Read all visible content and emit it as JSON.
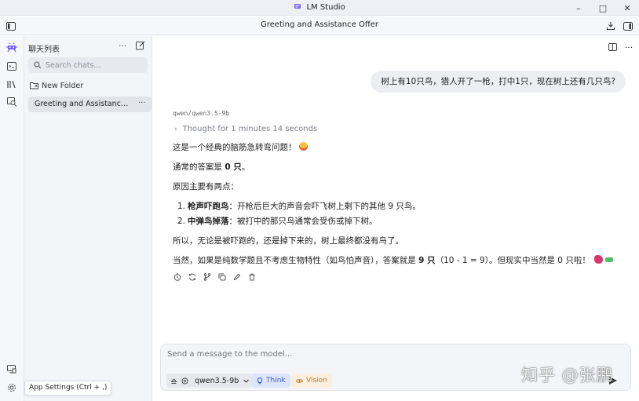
{
  "window": {
    "title": "LM Studio",
    "minimize": "–",
    "maximize": "□",
    "close": "✕"
  },
  "appbar": {
    "chat_title": "Greeting and Assistance Offer"
  },
  "sidebar": {
    "header": "聊天列表",
    "more": "···",
    "search_placeholder": "Search chats...",
    "folder_label": "New Folder",
    "chats": [
      {
        "label": "Greeting and Assistance Offer",
        "more": "···"
      }
    ],
    "tooltip": "App Settings (Ctrl + ,)"
  },
  "main": {
    "more": "···",
    "user_message": "树上有10只鸟，猎人开了一枪，打中1只，现在树上还有几只鸟?",
    "model_name": "qwen/qwen3.5-9b",
    "thought_label": "Thought for 1 minutes 14 seconds",
    "response": {
      "p1": "这是一个经典的脑筋急转弯问题！",
      "p2_prefix": "通常的答案是 ",
      "p2_bold": "0 只",
      "p2_suffix": "。",
      "p3": "原因主要有两点：",
      "list": [
        {
          "num": "1.",
          "bold": "枪声吓跑鸟",
          "text": "：开枪后巨大的声音会吓飞树上剩下的其他 9 只鸟。"
        },
        {
          "num": "2.",
          "bold": "中弹鸟掉落",
          "text": "：被打中的那只鸟通常会受伤或掉下树。"
        }
      ],
      "p4": "所以，无论是被吓跑的，还是掉下来的，树上最终都没有鸟了。",
      "p5_prefix": "当然，如果是纯数学题且不考虑生物特性（如鸟怕声音），答案就是 ",
      "p5_bold": "9 只",
      "p5_suffix": "（10 - 1 = 9）。但现实中当然是 0 只啦！"
    }
  },
  "composer": {
    "placeholder": "Send a message to the model...",
    "model": "qwen3.5-9b",
    "think_label": "Think",
    "vision_label": "Vision"
  },
  "watermark": "知乎 @张鹏",
  "colors": {
    "think": "#3a5bc7",
    "vision": "#b77a22",
    "accent": "#7b61ff"
  }
}
